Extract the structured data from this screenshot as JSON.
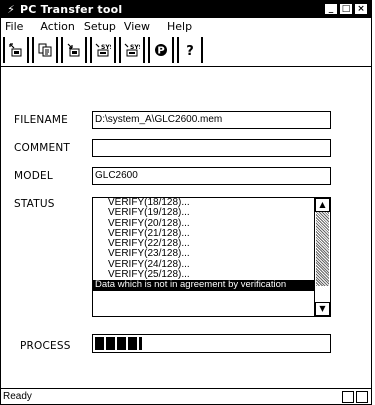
{
  "window": {
    "title": "PC Transfer tool",
    "title_icon": "lightning-icon",
    "controls": {
      "minimize": "_",
      "maximize": "□",
      "close": "×"
    }
  },
  "menu": [
    "File",
    "Action",
    "Setup",
    "View",
    "Help"
  ],
  "toolbar": {
    "buttons": [
      {
        "icon": "send-to-unit-icon"
      },
      {
        "icon": "copy-document-icon"
      },
      {
        "icon": "receive-from-unit-icon"
      },
      {
        "icon": "send-system-icon"
      },
      {
        "icon": "receive-system-icon"
      },
      {
        "icon": "protect-icon",
        "glyph": "P"
      },
      {
        "icon": "help-icon",
        "glyph": "?"
      }
    ]
  },
  "form": {
    "filename_label": "FILENAME",
    "filename_value": "D:\\system_A\\GLC2600.mem",
    "comment_label": "COMMENT",
    "comment_value": "",
    "model_label": "MODEL",
    "model_value": "GLC2600",
    "status_label": "STATUS",
    "process_label": "PROCESS"
  },
  "status_list": {
    "items": [
      "VERIFY(18/128)...",
      "VERIFY(19/128)...",
      "VERIFY(20/128)...",
      "VERIFY(21/128)...",
      "VERIFY(22/128)...",
      "VERIFY(23/128)...",
      "VERIFY(24/128)...",
      "VERIFY(25/128)...",
      "Data which is not in agreement by verification"
    ],
    "selected_index": 8
  },
  "progress": {
    "percent": 20
  },
  "statusbar": {
    "text": "Ready"
  }
}
